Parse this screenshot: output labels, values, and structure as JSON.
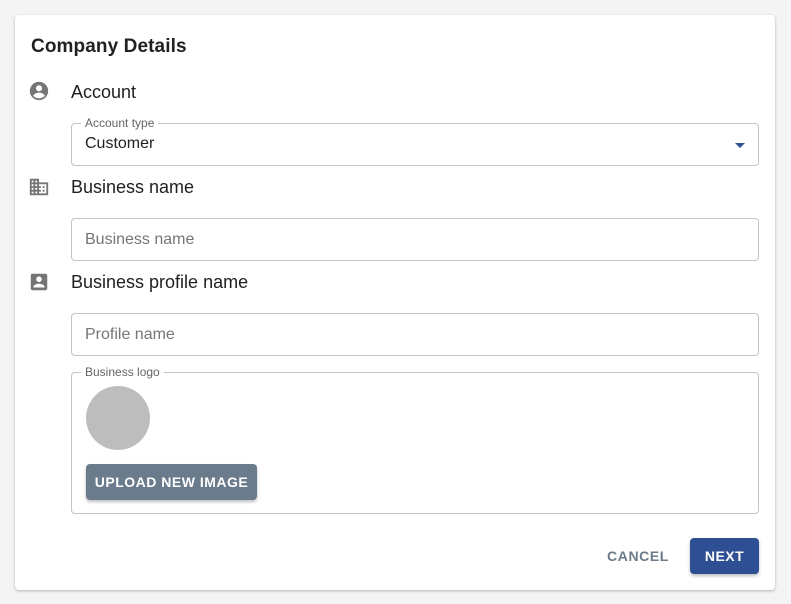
{
  "card": {
    "title": "Company Details"
  },
  "account": {
    "section_label": "Account",
    "icon": "account-circle-icon",
    "field_legend": "Account type",
    "selected_value": "Customer"
  },
  "business_name": {
    "section_label": "Business name",
    "icon": "building-icon",
    "placeholder": "Business name",
    "value": ""
  },
  "profile_name": {
    "section_label": "Business profile name",
    "icon": "account-box-icon",
    "placeholder": "Profile name",
    "value": ""
  },
  "logo": {
    "field_legend": "Business logo",
    "upload_label": "UPLOAD NEW IMAGE"
  },
  "actions": {
    "cancel_label": "CANCEL",
    "next_label": "NEXT"
  },
  "colors": {
    "primary": "#2f4f94",
    "upload_button": "#6a7b8b",
    "icon": "#757575",
    "avatar_placeholder": "#bdbdbd"
  }
}
